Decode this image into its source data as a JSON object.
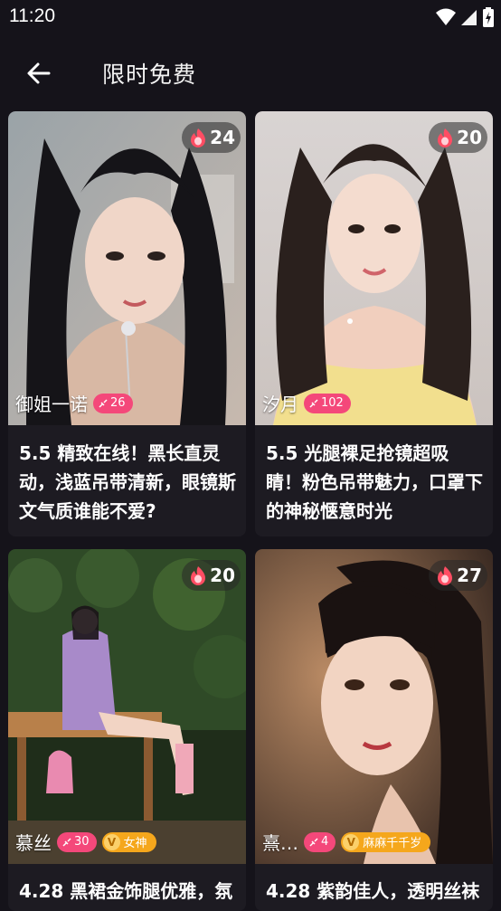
{
  "status": {
    "time": "11:20"
  },
  "header": {
    "title": "限时免费"
  },
  "cards": [
    {
      "author": "御姐一诺",
      "fans": "26",
      "hot": "24",
      "vip": "",
      "title": "5.5 精致在线！黑长直灵动，浅蓝吊带清新，眼镜斯文气质谁能不爱?"
    },
    {
      "author": "汐月",
      "fans": "102",
      "hot": "20",
      "vip": "",
      "title": "5.5 光腿裸足抢镜超吸睛！粉色吊带魅力，口罩下的神秘惬意时光"
    },
    {
      "author": "慕丝",
      "fans": "30",
      "hot": "20",
      "vip": "女神",
      "title": "4.28 黑裙金饰腿优雅，氛"
    },
    {
      "author": "熹…",
      "fans": "4",
      "hot": "27",
      "vip": "麻麻千千岁",
      "title": "4.28 紫韵佳人，透明丝袜"
    }
  ],
  "colors": {
    "fans": "#f4487a",
    "vip": "#f5a71c",
    "background": "#15131a"
  }
}
